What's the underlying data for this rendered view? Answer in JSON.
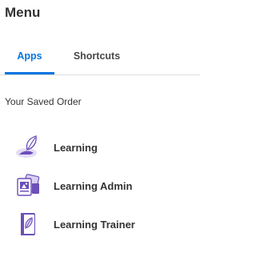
{
  "header": {
    "title": "Menu"
  },
  "tabs": [
    {
      "label": "Apps",
      "active": true
    },
    {
      "label": "Shortcuts",
      "active": false
    }
  ],
  "section": {
    "label": "Your Saved Order"
  },
  "apps": [
    {
      "label": "Learning",
      "icon": "learning-icon"
    },
    {
      "label": "Learning Admin",
      "icon": "learning-admin-icon"
    },
    {
      "label": "Learning Trainer",
      "icon": "learning-trainer-icon"
    }
  ],
  "colors": {
    "accent": "#0875e1",
    "icon_primary": "#6c4fb8",
    "icon_light": "#d9cff3"
  }
}
